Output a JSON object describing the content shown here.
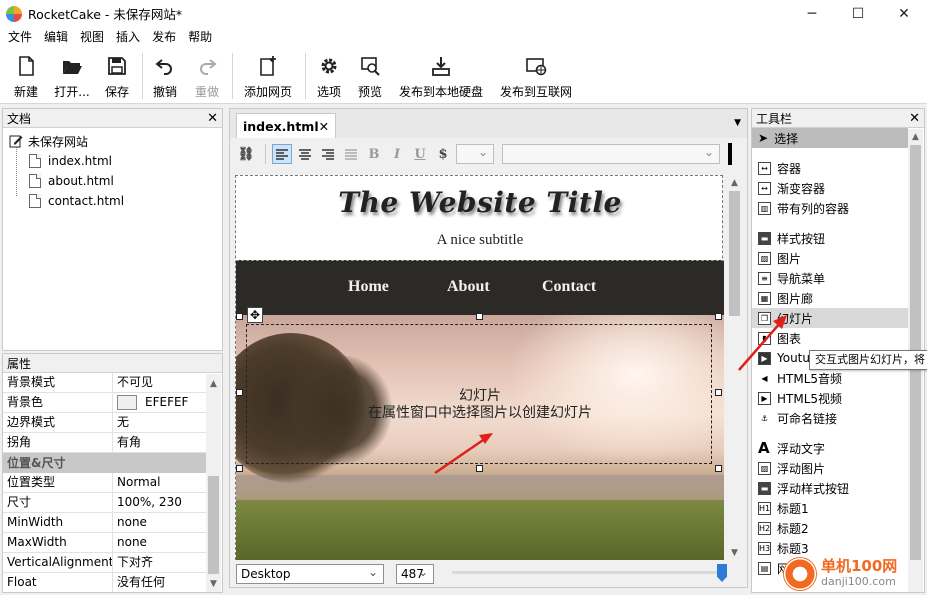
{
  "window": {
    "app_name": "RocketCake",
    "title": "RocketCake - 未保存网站*",
    "minimize": "─",
    "maximize": "☐",
    "close": "✕"
  },
  "menu": [
    "文件",
    "编辑",
    "视图",
    "插入",
    "发布",
    "帮助"
  ],
  "toolbar": {
    "new": "新建",
    "open": "打开...",
    "save": "保存",
    "undo": "撤销",
    "redo": "重做",
    "add_page": "添加网页",
    "options": "选项",
    "preview": "预览",
    "publish_local": "发布到本地硬盘",
    "publish_web": "发布到互联网"
  },
  "documents": {
    "title": "文档",
    "site": "未保存网站",
    "files": [
      "index.html",
      "about.html",
      "contact.html"
    ]
  },
  "properties": {
    "title": "属性",
    "rows": [
      {
        "key": "背景模式",
        "value": "不可见"
      },
      {
        "key": "背景色",
        "value": "EFEFEF",
        "swatch": "#efefef"
      },
      {
        "key": "边界模式",
        "value": "无"
      },
      {
        "key": "拐角",
        "value": "有角"
      }
    ],
    "section": "位置&尺寸",
    "rows2": [
      {
        "key": "位置类型",
        "value": "Normal"
      },
      {
        "key": "尺寸",
        "value": "100%, 230"
      },
      {
        "key": "MinWidth",
        "value": "none"
      },
      {
        "key": "MaxWidth",
        "value": "none"
      },
      {
        "key": "VerticalAlignment",
        "value": "下对齐"
      },
      {
        "key": "Float",
        "value": "没有任何"
      }
    ]
  },
  "editor": {
    "tab": "index.html",
    "site_title": "The Website Title",
    "subtitle": "A nice subtitle",
    "nav": [
      "Home",
      "About",
      "Contact"
    ],
    "slideshow_title": "幻灯片",
    "slideshow_hint": "在属性窗口中选择图片以创建幻灯片",
    "device": "Desktop",
    "width": "487",
    "zoom_fraction": 1.0
  },
  "toolbox": {
    "title": "工具栏",
    "select": "选择",
    "group1": [
      "容器",
      "渐变容器",
      "带有列的容器"
    ],
    "group2": [
      "样式按钮",
      "图片",
      "导航菜单",
      "图片廊",
      "幻灯片",
      "图表",
      "Youtube",
      "HTML5音频",
      "HTML5视频",
      "可命名链接"
    ],
    "group3": [
      "浮动文字",
      "浮动图片",
      "浮动样式按钮",
      "标题1",
      "标题2",
      "标题3",
      "网页表"
    ],
    "tooltip": "交互式图片幻灯片，将"
  },
  "watermark": {
    "line1": "单机100网",
    "line2": "danji100.com"
  }
}
